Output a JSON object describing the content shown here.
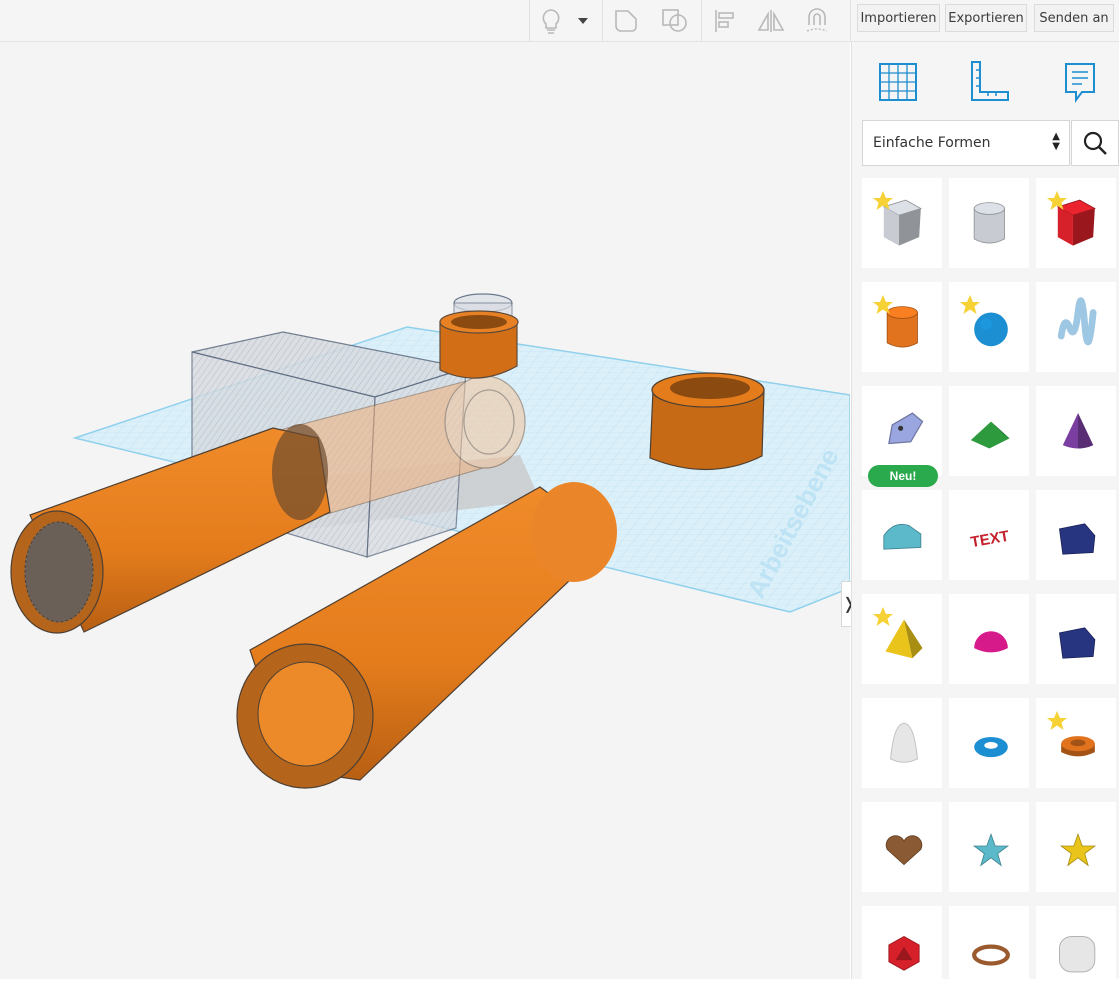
{
  "toolbar": {
    "import_label": "Importieren",
    "export_label": "Exportieren",
    "send_label": "Senden an"
  },
  "workplane": {
    "label": "Arbeitsebene"
  },
  "panel": {
    "collapse_glyph": "❭",
    "category_select": "Einfache Formen",
    "tabs": [
      "workplane-grid-icon",
      "ruler-icon",
      "notes-icon"
    ]
  },
  "shapes": [
    {
      "name": "box-hole",
      "star": true,
      "color": "#c8ccd2"
    },
    {
      "name": "cylinder-hole",
      "star": false,
      "color": "#c8ccd2"
    },
    {
      "name": "box",
      "star": true,
      "color": "#d6202a"
    },
    {
      "name": "cylinder",
      "star": true,
      "color": "#e2731e"
    },
    {
      "name": "sphere",
      "star": true,
      "color": "#1b8fd2"
    },
    {
      "name": "scribble",
      "star": false,
      "color": "#9ec7e3"
    },
    {
      "name": "shape-generator",
      "star": false,
      "badge": "Neu!",
      "color": "#9aa6e0"
    },
    {
      "name": "roof",
      "star": false,
      "color": "#2d9a3d"
    },
    {
      "name": "cone",
      "star": false,
      "color": "#7a3ea0"
    },
    {
      "name": "round-roof",
      "star": false,
      "color": "#5bb9c9"
    },
    {
      "name": "text",
      "star": false,
      "color": "#c3202c"
    },
    {
      "name": "wedge",
      "star": false,
      "color": "#27347f"
    },
    {
      "name": "pyramid",
      "star": true,
      "color": "#e9c51b"
    },
    {
      "name": "half-sphere",
      "star": false,
      "color": "#d61a8a"
    },
    {
      "name": "polygon",
      "star": false,
      "color": "#27347f"
    },
    {
      "name": "paraboloid",
      "star": false,
      "color": "#e6e6e6"
    },
    {
      "name": "torus",
      "star": false,
      "color": "#1b8fd2"
    },
    {
      "name": "tube",
      "star": true,
      "color": "#e2731e"
    },
    {
      "name": "heart",
      "star": false,
      "color": "#8a5a34"
    },
    {
      "name": "star",
      "star": false,
      "color": "#5bb9c9"
    },
    {
      "name": "star-yellow",
      "star": false,
      "color": "#e9c51b"
    },
    {
      "name": "icosahedron",
      "star": false,
      "color": "#d6202a"
    },
    {
      "name": "ring",
      "star": false,
      "color": "#9a5a2e"
    },
    {
      "name": "rounded-box",
      "star": false,
      "color": "#e6e6e6"
    }
  ]
}
